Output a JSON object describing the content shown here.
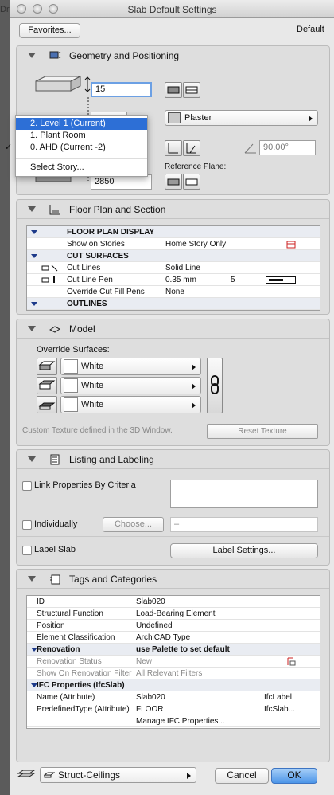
{
  "window": {
    "title": "Slab Default Settings",
    "bg_fragment": "Dra"
  },
  "top": {
    "favorites_label": "Favorites...",
    "default_label": "Default"
  },
  "geometry": {
    "title": "Geometry and Positioning",
    "thickness": "15",
    "elevation": "2850",
    "surface_material": "Plaster",
    "angle": "90.00°",
    "reference_plane_label": "Reference Plane:",
    "story_menu": [
      {
        "label": "2. Level 1 (Current)",
        "selected": true,
        "checked": false
      },
      {
        "label": "1. Plant Room",
        "selected": false,
        "checked": false
      },
      {
        "label": "0. AHD (Current -2)",
        "selected": false,
        "checked": true
      },
      {
        "label": "Select Story...",
        "selected": false,
        "checked": false
      }
    ],
    "check_mark": "✓"
  },
  "floorplan": {
    "title": "Floor Plan and Section",
    "rows": [
      {
        "name": "FLOOR PLAN DISPLAY",
        "value": "",
        "extra": "",
        "header": true
      },
      {
        "name": "Show on Stories",
        "value": "Home Story Only",
        "extra": "",
        "header": false
      },
      {
        "name": "CUT SURFACES",
        "value": "",
        "extra": "",
        "header": true
      },
      {
        "name": "Cut Lines",
        "value": "Solid Line",
        "extra": "",
        "header": false
      },
      {
        "name": "Cut Line Pen",
        "value": "0.35 mm",
        "extra": "5",
        "header": false
      },
      {
        "name": "Override Cut Fill Pens",
        "value": "None",
        "extra": "",
        "header": false
      },
      {
        "name": "OUTLINES",
        "value": "",
        "extra": "",
        "header": true
      }
    ]
  },
  "model": {
    "title": "Model",
    "override_label": "Override Surfaces:",
    "surfaces": [
      "White",
      "White",
      "White"
    ],
    "custom_texture_note": "Custom Texture defined in the 3D Window.",
    "reset_texture_label": "Reset Texture"
  },
  "listing": {
    "title": "Listing and Labeling",
    "link_label": "Link Properties By Criteria",
    "individually_label": "Individually",
    "choose_label": "Choose...",
    "choose_value": "–",
    "label_slab_label": "Label Slab",
    "label_settings_label": "Label Settings..."
  },
  "tags": {
    "title": "Tags and Categories",
    "rows": [
      {
        "name": "ID",
        "value": "Slab020",
        "extra": "",
        "style": "normal"
      },
      {
        "name": "Structural Function",
        "value": "Load-Bearing Element",
        "extra": "",
        "style": "normal"
      },
      {
        "name": "Position",
        "value": "Undefined",
        "extra": "",
        "style": "normal"
      },
      {
        "name": "Element Classification",
        "value": "ArchiCAD Type",
        "extra": "",
        "style": "normal"
      },
      {
        "name": "Renovation",
        "value": "use Palette to set default",
        "extra": "",
        "style": "header"
      },
      {
        "name": "Renovation Status",
        "value": "New",
        "extra": "",
        "style": "gray"
      },
      {
        "name": "Show On Renovation Filter",
        "value": "All Relevant Filters",
        "extra": "",
        "style": "gray"
      },
      {
        "name": "IFC Properties (IfcSlab)",
        "value": "",
        "extra": "",
        "style": "header"
      },
      {
        "name": "Name (Attribute)",
        "value": "Slab020",
        "extra": "IfcLabel",
        "style": "normal"
      },
      {
        "name": "PredefinedType (Attribute)",
        "value": "FLOOR",
        "extra": "IfcSlab...",
        "style": "normal"
      },
      {
        "name": "",
        "value": "Manage IFC Properties...",
        "extra": "",
        "style": "normal"
      }
    ]
  },
  "footer": {
    "layer": "Struct-Ceilings",
    "cancel_label": "Cancel",
    "ok_label": "OK"
  },
  "colors": {
    "selection": "#2d6fd6",
    "ok_button": "#6aa9f0"
  }
}
